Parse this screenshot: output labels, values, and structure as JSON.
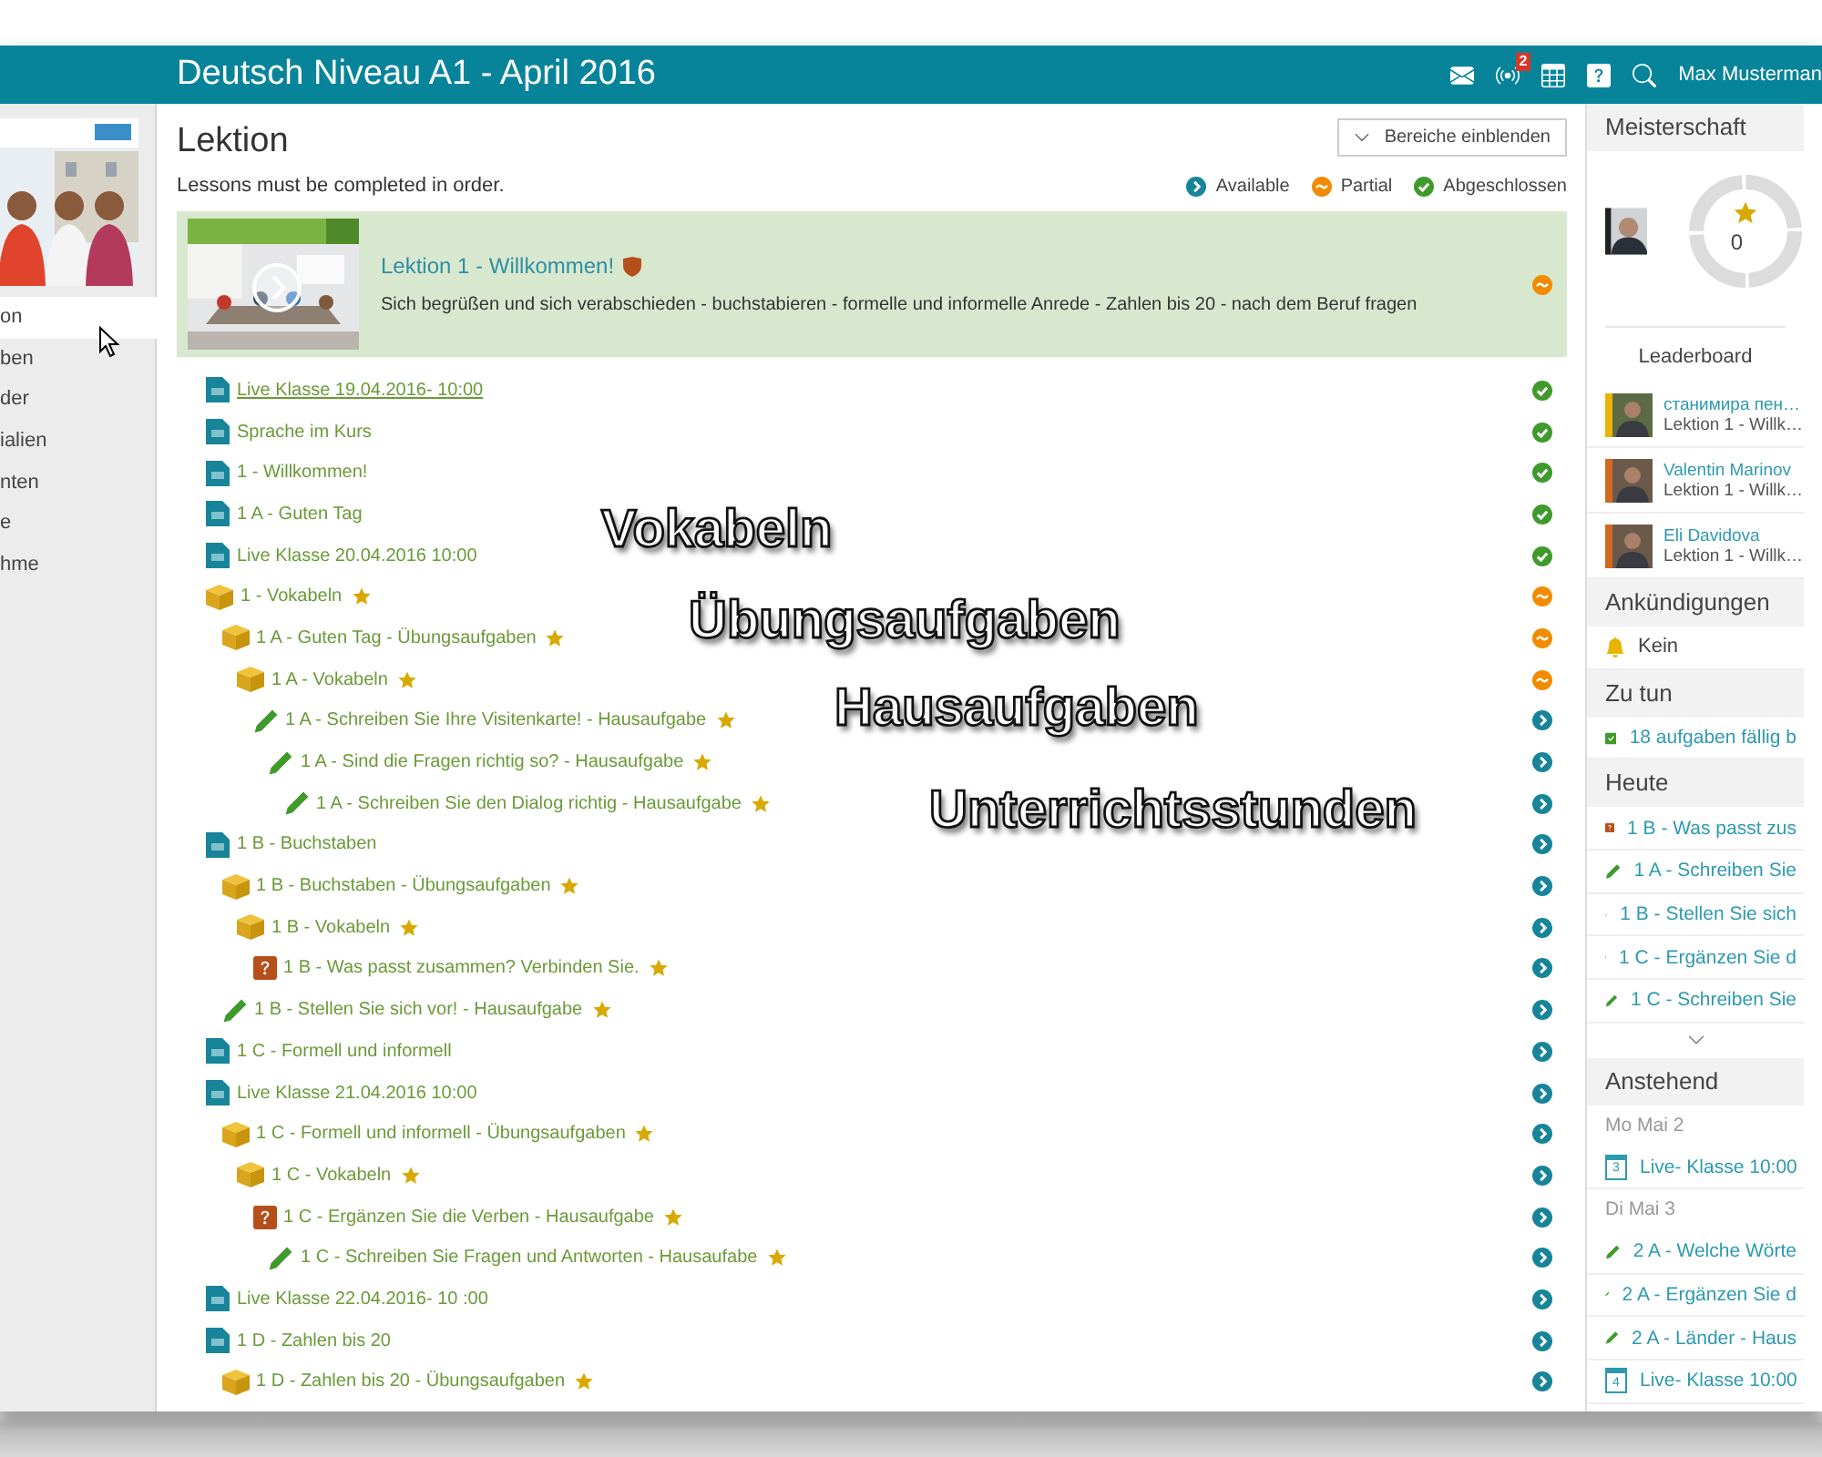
{
  "header": {
    "title": "Deutsch Niveau A1 - April 2016",
    "notification_count": "2",
    "user": "Max Musterman"
  },
  "sidebar": {
    "items": [
      {
        "label": "on",
        "selected": true
      },
      {
        "label": "ben",
        "selected": false
      },
      {
        "label": "der",
        "selected": false
      },
      {
        "label": "ialien",
        "selected": false
      },
      {
        "label": "nten",
        "selected": false
      },
      {
        "label": "e",
        "selected": false
      },
      {
        "label": "hme",
        "selected": false
      }
    ]
  },
  "main": {
    "title": "Lektion",
    "notice": "Lessons must be completed in order.",
    "toggle_button": "Bereiche einblenden",
    "legend": [
      {
        "status": {
          "kind": "available"
        },
        "label": "Available"
      },
      {
        "status": {
          "kind": "partial"
        },
        "label": "Partial"
      },
      {
        "status": {
          "kind": "complete"
        },
        "label": "Abgeschlossen"
      }
    ],
    "lesson": {
      "title": "Lektion 1 - Willkommen!",
      "description": "Sich begrüßen und sich verabschieden - buchstabieren - formelle und informelle Anrede - Zahlen bis 20 - nach dem Beruf fragen",
      "status": {
        "kind": "partial"
      }
    },
    "items": [
      {
        "kind": "page",
        "label": "Live Klasse 19.04.2016- 10:00",
        "starred": false,
        "hovered": true,
        "status": {
          "kind": "complete"
        }
      },
      {
        "kind": "page",
        "label": "Sprache im Kurs",
        "starred": false,
        "hovered": false,
        "status": {
          "kind": "complete"
        }
      },
      {
        "kind": "page",
        "label": "1 - Willkommen!",
        "starred": false,
        "hovered": false,
        "status": {
          "kind": "complete"
        }
      },
      {
        "kind": "page",
        "label": "1 A - Guten Tag",
        "starred": false,
        "hovered": false,
        "status": {
          "kind": "complete"
        }
      },
      {
        "kind": "page",
        "label": "Live Klasse 20.04.2016 10:00",
        "starred": false,
        "hovered": false,
        "status": {
          "kind": "complete"
        }
      },
      {
        "kind": "cube",
        "label": "1 - Vokabeln",
        "starred": true,
        "hovered": false,
        "status": {
          "kind": "partial"
        },
        "children": [
          {
            "kind": "cube",
            "label": "1 A - Guten Tag - Übungsaufgaben",
            "starred": true,
            "hovered": false,
            "status": {
              "kind": "partial"
            },
            "children": [
              {
                "kind": "cube",
                "label": "1 A - Vokabeln",
                "starred": true,
                "hovered": false,
                "status": {
                  "kind": "partial"
                },
                "children": [
                  {
                    "kind": "pencil",
                    "label": "1 A - Schreiben Sie Ihre Visitenkarte! - Hausaufgabe",
                    "starred": true,
                    "hovered": false,
                    "status": {
                      "kind": "available"
                    },
                    "children": [
                      {
                        "kind": "pencil",
                        "label": "1 A - Sind die Fragen richtig so? - Hausaufgabe",
                        "starred": true,
                        "hovered": false,
                        "status": {
                          "kind": "available"
                        },
                        "children": [
                          {
                            "kind": "pencil",
                            "label": "1 A - Schreiben Sie den Dialog richtig - Hausaufgabe",
                            "starred": true,
                            "hovered": false,
                            "status": {
                              "kind": "available"
                            }
                          }
                        ]
                      }
                    ]
                  }
                ]
              }
            ]
          }
        ]
      },
      {
        "kind": "page",
        "label": "1 B - Buchstaben",
        "starred": false,
        "hovered": false,
        "status": {
          "kind": "available"
        },
        "children": [
          {
            "kind": "cube",
            "label": "1 B - Buchstaben - Übungsaufgaben",
            "starred": true,
            "hovered": false,
            "status": {
              "kind": "available"
            },
            "children": [
              {
                "kind": "cube",
                "label": "1 B - Vokabeln",
                "starred": true,
                "hovered": false,
                "status": {
                  "kind": "available"
                },
                "children": [
                  {
                    "kind": "quiz",
                    "label": "1 B - Was passt zusammen? Verbinden Sie.",
                    "starred": true,
                    "hovered": false,
                    "status": {
                      "kind": "available"
                    }
                  }
                ]
              }
            ]
          },
          {
            "kind": "pencil",
            "label": "1 B - Stellen Sie sich vor! - Hausaufgabe",
            "starred": true,
            "hovered": false,
            "status": {
              "kind": "available"
            }
          }
        ]
      },
      {
        "kind": "page",
        "label": "1 C - Formell und informell",
        "starred": false,
        "hovered": false,
        "status": {
          "kind": "available"
        }
      },
      {
        "kind": "page",
        "label": "Live Klasse 21.04.2016 10:00",
        "starred": false,
        "hovered": false,
        "status": {
          "kind": "available"
        },
        "children": [
          {
            "kind": "cube",
            "label": "1 C - Formell und informell - Übungsaufgaben",
            "starred": true,
            "hovered": false,
            "status": {
              "kind": "available"
            },
            "children": [
              {
                "kind": "cube",
                "label": "1 C - Vokabeln",
                "starred": true,
                "hovered": false,
                "status": {
                  "kind": "available"
                },
                "children": [
                  {
                    "kind": "quiz",
                    "label": "1 C - Ergänzen Sie die Verben - Hausaufgabe",
                    "starred": true,
                    "hovered": false,
                    "status": {
                      "kind": "available"
                    },
                    "children": [
                      {
                        "kind": "pencil",
                        "label": "1 C - Schreiben Sie Fragen und Antworten - Hausaufabe",
                        "starred": true,
                        "hovered": false,
                        "status": {
                          "kind": "available"
                        }
                      }
                    ]
                  }
                ]
              }
            ]
          }
        ]
      },
      {
        "kind": "page",
        "label": "Live Klasse 22.04.2016- 10 :00",
        "starred": false,
        "hovered": false,
        "status": {
          "kind": "available"
        }
      },
      {
        "kind": "page",
        "label": "1 D - Zahlen bis 20",
        "starred": false,
        "hovered": false,
        "status": {
          "kind": "available"
        },
        "children": [
          {
            "kind": "cube",
            "label": "1 D - Zahlen bis 20 - Übungsaufgaben",
            "starred": true,
            "hovered": false,
            "status": {
              "kind": "available"
            }
          }
        ]
      }
    ]
  },
  "annotations": [
    "Vokabeln",
    "Übungsaufgaben",
    "Hausaufgaben",
    "Unterrichtsstunden"
  ],
  "right_panel": {
    "mastery": {
      "title": "Meisterschaft",
      "score": "0",
      "leaderboard_title": "Leaderboard",
      "leaders": [
        {
          "name": "станимира пен…",
          "lesson": "Lektion 1 - Willk…",
          "color": "#e8b400"
        },
        {
          "name": "Valentin Marinov",
          "lesson": "Lektion 1 - Willk…",
          "color": "#d2691e"
        },
        {
          "name": "Eli Davidova",
          "lesson": "Lektion 1 - Willk…",
          "color": "#d2691e"
        }
      ]
    },
    "announcements": {
      "title": "Ankündigungen",
      "items": [
        "Kein"
      ]
    },
    "todo": {
      "title": "Zu tun",
      "items": [
        "18 aufgaben fällig b"
      ]
    },
    "today": {
      "title": "Heute",
      "items": [
        {
          "kind": "quiz",
          "label": "1 B - Was passt zus"
        },
        {
          "kind": "pencil",
          "label": "1 A - Schreiben Sie"
        },
        {
          "kind": "pencil",
          "label": "1 B - Stellen Sie sich"
        },
        {
          "kind": "quiz",
          "label": "1 C - Ergänzen Sie d"
        },
        {
          "kind": "pencil",
          "label": "1 C - Schreiben Sie"
        }
      ]
    },
    "upcoming": {
      "title": "Anstehend",
      "groups": [
        {
          "date": "Mo Mai 2",
          "items": [
            {
              "kind": "calendar",
              "day": "3",
              "label": "Live- Klasse 10:00"
            }
          ]
        },
        {
          "date": "Di Mai 3",
          "items": [
            {
              "kind": "pencil",
              "label": "2 A - Welche Wörte"
            },
            {
              "kind": "pencil",
              "label": "2 A - Ergänzen Sie d"
            },
            {
              "kind": "pencil",
              "label": "2 A - Länder - Haus"
            },
            {
              "kind": "calendar",
              "day": "4",
              "label": "Live- Klasse 10:00"
            }
          ]
        }
      ]
    }
  }
}
